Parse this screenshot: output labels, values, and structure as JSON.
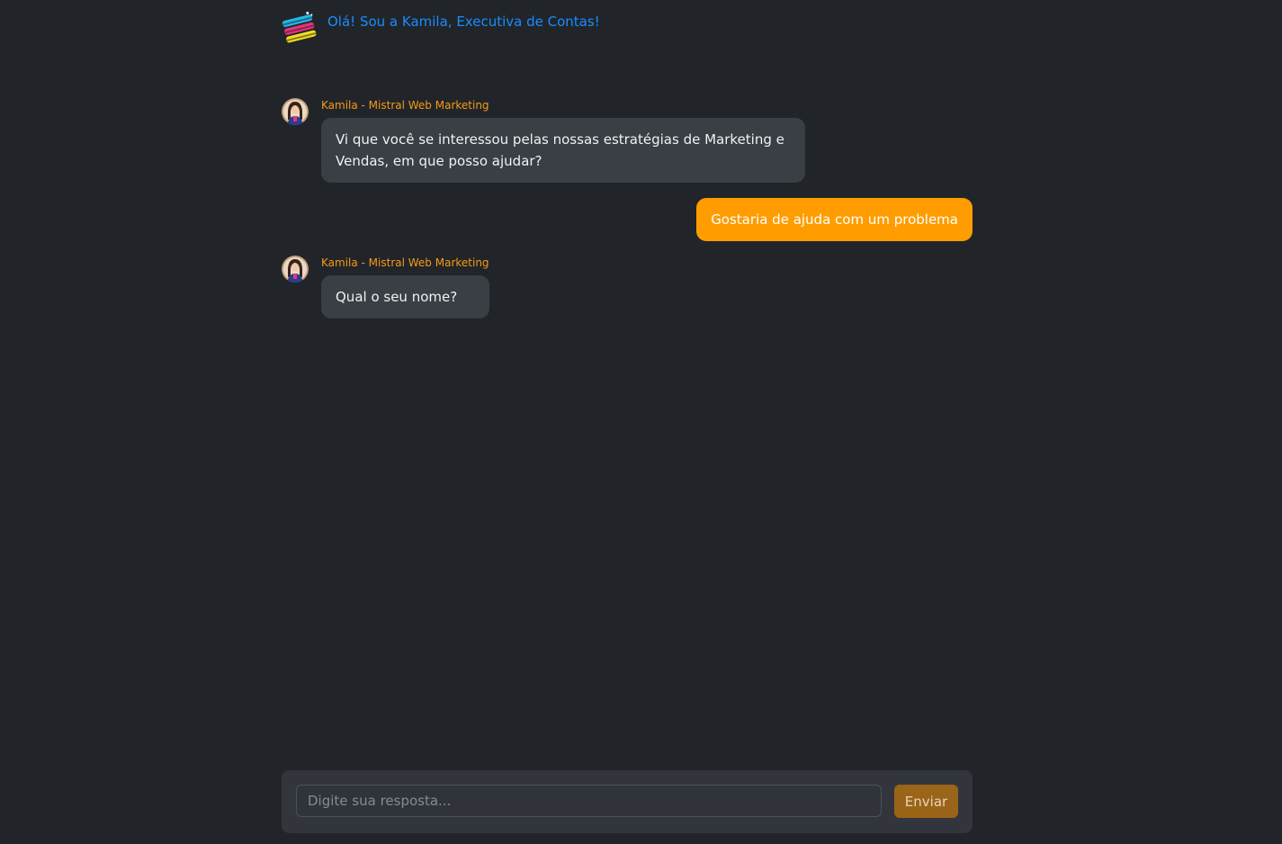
{
  "header": {
    "logo_icon": "colorful-stacked-stripes-logo",
    "title": "Olá! Sou a Kamila, Executiva de Contas!"
  },
  "messages": [
    {
      "role": "bot",
      "sender": "Kamila - Mistral Web Marketing",
      "avatar_icon": "agent-avatar",
      "text": "Vi que você se interessou pelas nossas estratégias de Marketing e Vendas, em que posso ajudar?"
    },
    {
      "role": "user",
      "text": "Gostaria de ajuda com um problema"
    },
    {
      "role": "bot",
      "sender": "Kamila - Mistral Web Marketing",
      "avatar_icon": "agent-avatar",
      "text": "Qual o seu nome?"
    }
  ],
  "composer": {
    "value": "",
    "placeholder": "Digite sua resposta...",
    "send_label": "Enviar"
  },
  "colors": {
    "background": "#212529",
    "accent_orange": "#ff9d00",
    "sender_orange": "#f59a17",
    "title_blue": "#1a8cff",
    "bot_bubble": "#3a3e45"
  }
}
